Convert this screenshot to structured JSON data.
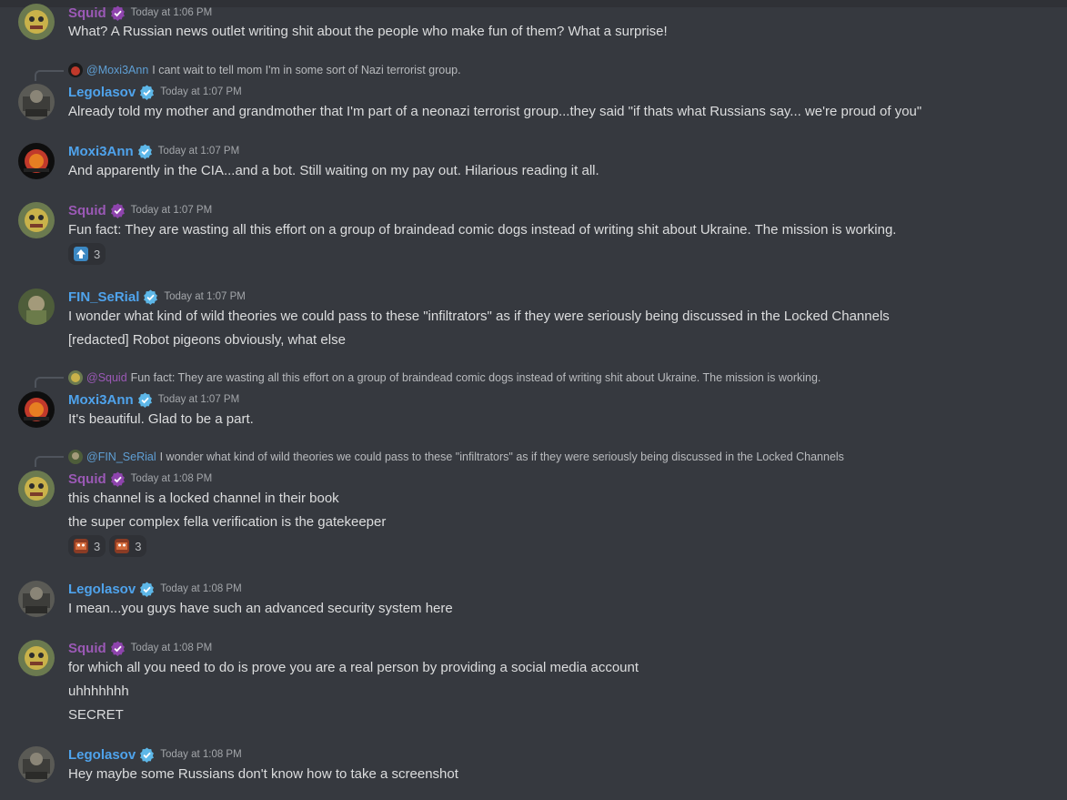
{
  "messages": [
    {
      "user": "Squid",
      "time": "Today at 1:06 PM",
      "lines": [
        "What? A Russian news outlet writing shit about the people who make fun of them? What a surprise!"
      ]
    },
    {
      "reply": {
        "name": "@Moxi3Ann",
        "text": "I cant wait to tell mom I'm in some sort of Nazi terrorist group."
      },
      "user": "Legolasov",
      "time": "Today at 1:07 PM",
      "lines": [
        "Already told my mother and grandmother that I'm part of a neonazi terrorist group...they said \"if thats what Russians say... we're proud of you\""
      ]
    },
    {
      "user": "Moxi3Ann",
      "time": "Today at 1:07 PM",
      "lines": [
        "And apparently in the CIA...and a bot. Still waiting on my pay out. Hilarious reading it all."
      ]
    },
    {
      "user": "Squid",
      "time": "Today at 1:07 PM",
      "lines": [
        "Fun fact: They are wasting all this effort on a group of braindead comic dogs instead of writing shit about Ukraine. The mission is working."
      ],
      "reactions": [
        {
          "emoji": "up-arrow-emoji",
          "count": "3"
        }
      ]
    },
    {
      "user": "FIN_SeRial",
      "time": "Today at 1:07 PM",
      "lines": [
        "I wonder what kind of wild theories we could pass to these \"infiltrators\" as if they were seriously being discussed in the Locked Channels",
        "[redacted] Robot pigeons obviously, what else"
      ]
    },
    {
      "reply": {
        "name": "@Squid",
        "text": "Fun fact: They are wasting all this effort on a group of braindead comic dogs instead of writing shit about Ukraine. The mission is working."
      },
      "user": "Moxi3Ann",
      "time": "Today at 1:07 PM",
      "lines": [
        "It's beautiful. Glad to be a part."
      ]
    },
    {
      "reply": {
        "name": "@FIN_SeRial",
        "text": "I wonder what kind of wild theories we could pass to these \"infiltrators\" as if they were seriously being discussed in the Locked Channels"
      },
      "user": "Squid",
      "time": "Today at 1:08 PM",
      "lines": [
        "this channel is a locked channel in their book",
        "the super complex fella verification is the gatekeeper"
      ],
      "reactions": [
        {
          "emoji": "custom-emoji",
          "count": "3"
        },
        {
          "emoji": "custom-emoji",
          "count": "3"
        }
      ]
    },
    {
      "user": "Legolasov",
      "time": "Today at 1:08 PM",
      "lines": [
        "I mean...you guys have such an advanced security system here"
      ]
    },
    {
      "user": "Squid",
      "time": "Today at 1:08 PM",
      "lines": [
        "for which all you need to do is prove you are a real person by providing a social media account",
        "uhhhhhhh",
        "SECRET"
      ]
    },
    {
      "user": "Legolasov",
      "time": "Today at 1:08 PM",
      "lines": [
        "Hey maybe some Russians don't know how to take a screenshot"
      ]
    }
  ],
  "colors": {
    "background": "#36393f",
    "name_blue": "#4fa3ec",
    "name_purple": "#9b59b6",
    "badge_blue": "#5db7e8",
    "badge_purple": "#8e44ad"
  }
}
